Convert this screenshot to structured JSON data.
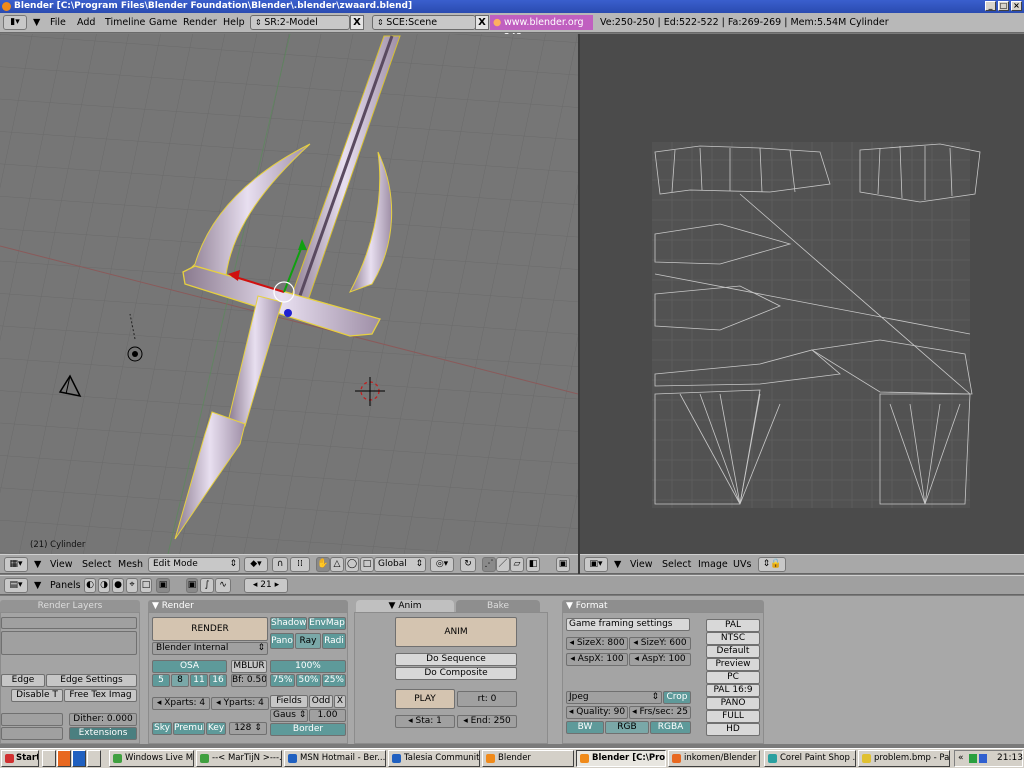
{
  "window": {
    "title": "Blender [C:\\Program Files\\Blender Foundation\\Blender\\.blender\\zwaard.blend]"
  },
  "menubar": {
    "items": [
      "File",
      "Add",
      "Timeline",
      "Game",
      "Render",
      "Help"
    ],
    "screen": "SR:2-Model",
    "scene": "SCE:Scene",
    "url": "www.blender.org 243",
    "stats": "Ve:250-250 | Ed:522-522 | Fa:269-269 | Mem:5.54M Cylinder"
  },
  "view3d": {
    "object_label": "(21) Cylinder",
    "header": {
      "view": "View",
      "select": "Select",
      "mesh": "Mesh",
      "mode": "Edit Mode",
      "orientation": "Global"
    }
  },
  "uv_editor": {
    "header": {
      "view": "View",
      "select": "Select",
      "image": "Image",
      "uvs": "UVs"
    }
  },
  "buttons_header": {
    "panels": "Panels",
    "frame": "21"
  },
  "panels": {
    "render_layers": {
      "tab": "Render Layers",
      "edge": "Edge",
      "edge_settings": "Edge Settings",
      "disable_tex": "Disable T",
      "free_tex": "Free Tex Imag",
      "dither": "Dither: 0.000",
      "extensions": "Extensions"
    },
    "render": {
      "tab": "Render",
      "render_btn": "RENDER",
      "renderer": "Blender Internal",
      "shadow": "Shadow",
      "envmap": "EnvMap",
      "pano": "Pano",
      "ray": "Ray",
      "radi": "Radi",
      "osa": "OSA",
      "osa_values": [
        "5",
        "8",
        "11",
        "16"
      ],
      "mblur": "MBLUR",
      "bf": "Bf: 0.50",
      "percent_label": "100%",
      "percents": [
        "75%",
        "50%",
        "25%"
      ],
      "xparts": "Xparts: 4",
      "yparts": "Yparts: 4",
      "fields": "Fields",
      "odd": "Odd",
      "x": "X",
      "gaus": "Gaus",
      "gaus_val": "1.00",
      "sky": "Sky",
      "premul": "Premul",
      "key": "Key",
      "size": "128",
      "border": "Border"
    },
    "anim": {
      "tab": "Anim",
      "bake_tab": "Bake",
      "anim_btn": "ANIM",
      "do_sequence": "Do Sequence",
      "do_composite": "Do Composite",
      "play": "PLAY",
      "rt": "rt: 0",
      "sta": "Sta: 1",
      "end": "End: 250"
    },
    "format": {
      "tab": "Format",
      "game_framing": "Game framing settings",
      "sizex": "SizeX: 800",
      "sizey": "SizeY: 600",
      "aspx": "AspX: 100",
      "aspy": "AspY: 100",
      "jpeg": "Jpeg",
      "crop": "Crop",
      "quality": "Quality: 90",
      "fps": "Frs/sec: 25",
      "bw": "BW",
      "rgb": "RGB",
      "rgba": "RGBA",
      "presets": [
        "PAL",
        "NTSC",
        "Default",
        "Preview",
        "PC",
        "PAL 16:9",
        "PANO",
        "FULL",
        "HD"
      ]
    }
  },
  "taskbar": {
    "start": "Start",
    "tasks": [
      "Windows Live Me...",
      "--< MarTijN >---...",
      "MSN Hotmail - Ber...",
      "Talesia Communit...",
      "Blender",
      "Blender [C:\\Pro...",
      "inkomen/Blender ...",
      "Corel Paint Shop ...",
      "problem.bmp - Paint"
    ],
    "clock": "21:13"
  },
  "colors": {
    "wire": "#f0e040",
    "uv_grid": "#5a5a5a",
    "accent_teal": "#5e9a9a"
  }
}
